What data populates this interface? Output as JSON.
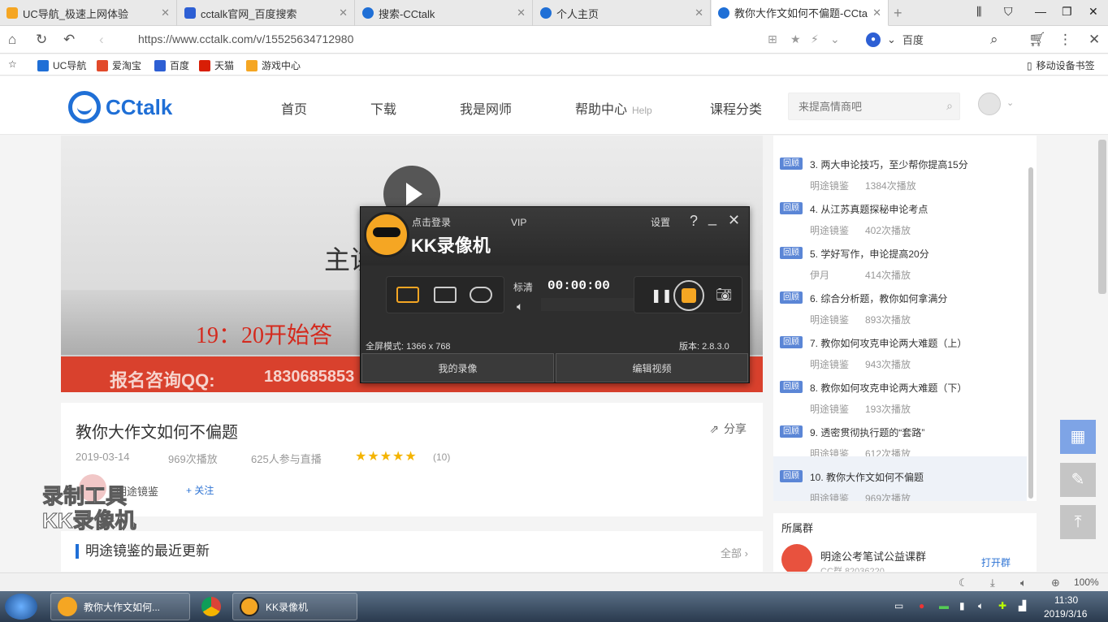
{
  "browser": {
    "tabs": [
      {
        "title": "UC导航_极速上网体验",
        "color": "#f5a623"
      },
      {
        "title": "cctalk官网_百度搜索",
        "color": "#2d5fd4"
      },
      {
        "title": "搜索-CCtalk",
        "color": "#1f6fd6"
      },
      {
        "title": "个人主页",
        "color": "#1f6fd6"
      },
      {
        "title": "教你大作文如何不偏题-CCtalk",
        "color": "#1f6fd6"
      }
    ],
    "url": "https://www.cctalk.com/v/15525634712980",
    "search_engine": "百度",
    "bookmarks": [
      "UC导航",
      "爱淘宝",
      "百度",
      "天猫",
      "游戏中心"
    ],
    "bookmark_right": "移动设备书签",
    "zoom": "100%"
  },
  "site": {
    "logo": "CCtalk",
    "nav": [
      "首页",
      "下载",
      "我是网师",
      "帮助中心",
      "课程分类"
    ],
    "nav_help_sub": "Help",
    "search_placeholder": "来提高情商吧"
  },
  "video": {
    "heading": "主讲",
    "time_text": "19：20开始答",
    "qq_label": "报名咨询QQ:",
    "qq_number": "1830685853"
  },
  "recorder": {
    "login": "点击登录",
    "name": "KK录像机",
    "vip": "VIP",
    "settings": "设置",
    "quality": "标清",
    "timer": "00:00:00",
    "mode_info": "全屏模式: 1366 x 768",
    "version": "版本: 2.8.3.0",
    "btn_my": "我的录像",
    "btn_edit": "编辑视频"
  },
  "info": {
    "title": "教你大作文如何不偏题",
    "share": "分享",
    "date": "2019-03-14",
    "plays": "969次播放",
    "live": "625人参与直播",
    "rating": 5,
    "rating_count": "(10)",
    "teacher": "明途镜鉴",
    "follow": "+ 关注"
  },
  "watermark": {
    "line1": "录制工具",
    "line2": "KK录像机"
  },
  "updates": {
    "title": "明途镜鉴的最近更新",
    "all": "全部"
  },
  "playlist": [
    {
      "badge": "回顾",
      "title": "3. 两大申论技巧，至少帮你提高15分",
      "teacher": "明途镜鉴",
      "plays": "1384次播放",
      "current": false
    },
    {
      "badge": "回顾",
      "title": "4. 从江苏真题探秘申论考点",
      "teacher": "明途镜鉴",
      "plays": "402次播放",
      "current": false
    },
    {
      "badge": "回顾",
      "title": "5. 学好写作，申论提高20分",
      "teacher": "伊月",
      "plays": "414次播放",
      "current": false
    },
    {
      "badge": "回顾",
      "title": "6. 综合分析题，教你如何拿满分",
      "teacher": "明途镜鉴",
      "plays": "893次播放",
      "current": false
    },
    {
      "badge": "回顾",
      "title": "7. 教你如何攻克申论两大难题（上）",
      "teacher": "明途镜鉴",
      "plays": "943次播放",
      "current": false
    },
    {
      "badge": "回顾",
      "title": "8. 教你如何攻克申论两大难题（下）",
      "teacher": "明途镜鉴",
      "plays": "193次播放",
      "current": false
    },
    {
      "badge": "回顾",
      "title": "9. 透密贯彻执行题的“套路”",
      "teacher": "明途镜鉴",
      "plays": "612次播放",
      "current": false
    },
    {
      "badge": "回顾",
      "title": "10. 教你大作文如何不偏题",
      "teacher": "明途镜鉴",
      "plays": "969次播放",
      "current": true
    }
  ],
  "group": {
    "title": "所属群",
    "name": "明途公考笔试公益课群",
    "id": "CC群 82036220",
    "join": "打开群"
  },
  "taskbar": {
    "items": [
      "教你大作文如何...",
      "KK录像机"
    ],
    "time": "11:30",
    "date": "2019/3/16"
  }
}
